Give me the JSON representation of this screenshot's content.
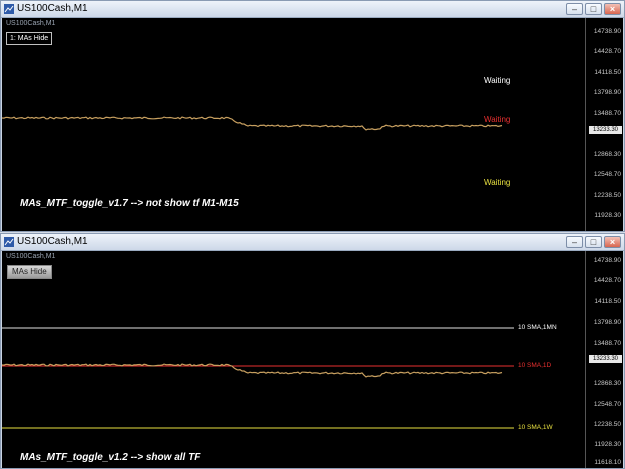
{
  "colors": {
    "background": "#000000",
    "price_line": "#c8a060",
    "white": "#ffffff",
    "red": "#e83030",
    "yellow": "#e8e040"
  },
  "top": {
    "title": "US100Cash,M1",
    "symbol": "US100Cash,M1",
    "button": "1: MAs Hide",
    "waiting": [
      "Waiting",
      "Waiting",
      "Waiting"
    ],
    "caption": "MAs_MTF_toggle_v1.7 --> not show tf M1-M15",
    "ticks": [
      "14738.90",
      "14428.70",
      "14118.50",
      "13798.90",
      "13488.70",
      "12868.30",
      "12548.70",
      "12238.50",
      "11928.30"
    ],
    "current_price": "13233.30"
  },
  "bottom": {
    "title": "US100Cash,M1",
    "symbol": "US100Cash,M1",
    "button": "MAs Hide",
    "sma": [
      "10 SMA,1MN",
      "10 SMA,1D",
      "10 SMA,1W"
    ],
    "caption": "MAs_MTF_toggle_v1.2 --> show all TF",
    "ticks": [
      "14738.90",
      "14428.70",
      "14118.50",
      "13798.90",
      "13488.70",
      "12868.30",
      "12548.70",
      "12238.50",
      "11928.30",
      "11618.10"
    ],
    "current_price": "13233.30"
  }
}
